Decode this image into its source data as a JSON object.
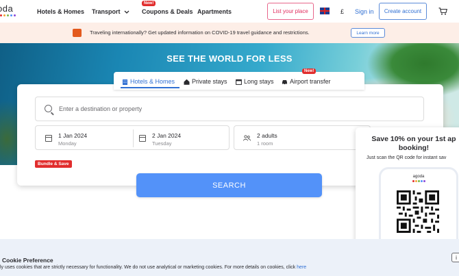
{
  "header": {
    "logo_text": "oda",
    "nav": [
      "Hotels & Homes",
      "Transport",
      "Coupons & Deals",
      "Apartments"
    ],
    "new_badge": "New!",
    "list_place": "List your place",
    "currency": "£",
    "sign_in": "Sign in",
    "create_account": "Create account"
  },
  "banner": {
    "text": "Traveling internationally? Get updated information on COVID-19 travel guidance and restrictions.",
    "learn_more": "Learn more"
  },
  "hero": {
    "title": "SEE THE WORLD FOR LESS"
  },
  "tabs": [
    {
      "label": "Hotels & Homes",
      "icon": "building-icon"
    },
    {
      "label": "Private stays",
      "icon": "house-icon"
    },
    {
      "label": "Long stays",
      "icon": "calendar-icon"
    },
    {
      "label": "Airport transfer",
      "icon": "car-icon",
      "badge": "New!"
    }
  ],
  "search": {
    "placeholder": "Enter a destination or property",
    "checkin": {
      "date": "1 Jan 2024",
      "day": "Monday"
    },
    "checkout": {
      "date": "2 Jan 2024",
      "day": "Tuesday"
    },
    "guests": {
      "main": "2 adults",
      "sub": "1 room"
    },
    "bundle_label": "Bundle & Save",
    "button": "SEARCH"
  },
  "promo": {
    "title_line1": "Save 10% on your 1st ap",
    "title_line2": "booking!",
    "subtitle": "Just scan the QR code for instant sav",
    "phone_logo": "agoda"
  },
  "cookie": {
    "title": "Cookie Preference",
    "text": "ly uses cookies that are strictly necessary for functionality. We do not use analytical or marketing cookies. For more details on cookies, click ",
    "link": "here",
    "close": "i"
  },
  "colors": {
    "accent": "#5392f9",
    "link": "#2f6fd3",
    "badge_red": "#e12d2d",
    "banner_bg": "#fdeee7",
    "cookie_bg": "#ecf1f9"
  }
}
